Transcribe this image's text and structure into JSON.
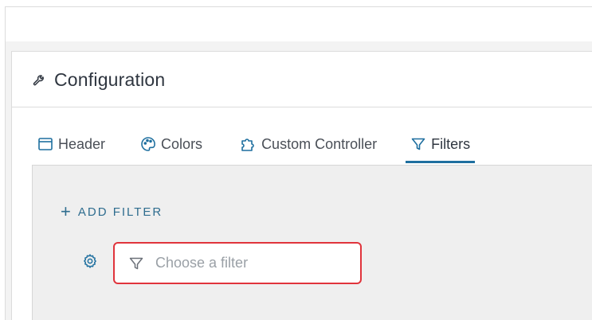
{
  "card": {
    "title": "Configuration",
    "title_icon": "wrench-icon"
  },
  "tabs": [
    {
      "label": "Header",
      "icon": "window-icon"
    },
    {
      "label": "Colors",
      "icon": "palette-icon"
    },
    {
      "label": "Custom Controller",
      "icon": "puzzle-icon"
    },
    {
      "label": "Filters",
      "icon": "filter-icon",
      "active": true
    }
  ],
  "filters_panel": {
    "add_filter_label": "ADD FILTER",
    "filter_input": {
      "value": "",
      "placeholder": "Choose a filter"
    }
  },
  "colors": {
    "accent": "#1e6f9f",
    "error_border": "#e0343c",
    "panel_bg": "#efefef"
  }
}
